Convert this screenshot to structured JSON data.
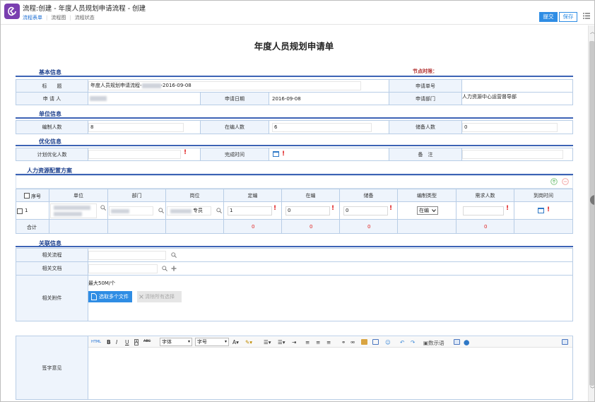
{
  "window": {
    "title": "流程:创建 - 年度人员规划申请流程 - 创建",
    "tabs": [
      "流程表单",
      "流程图",
      "流程状态"
    ],
    "submit_label": "提交",
    "save_label": "保存"
  },
  "form": {
    "title": "年度人员规划申请单",
    "node_time_label": "节点时限：",
    "basic": {
      "section": "基本信息",
      "title_label": "标　　题",
      "title_prefix": "年度人员规划申请流程-",
      "title_suffix": "-2016-09-08",
      "serial_label": "申请单号",
      "applicant_label": "申 请 人",
      "date_label": "申请日期",
      "date_value": "2016-09-08",
      "dept_label": "申请部门",
      "dept_value": "人力资源中心运营督导部"
    },
    "unit": {
      "section": "单位信息",
      "plan_label": "编制人数",
      "plan_value": "8",
      "current_label": "在编人数",
      "current_value": "6",
      "reserve_label": "储备人数",
      "reserve_value": "0"
    },
    "optimize": {
      "section": "优化信息",
      "plan_label": "计划优化人数",
      "finish_label": "完成时间",
      "remark_label": "备　注"
    },
    "staffing": {
      "section": "人力资源配置方案",
      "columns": [
        "序号",
        "单位",
        "部门",
        "岗位",
        "定编",
        "在编",
        "储备",
        "编制类型",
        "需求人数",
        "到岗时间"
      ],
      "row": {
        "index": "1",
        "position_suffix": "专员",
        "fixed": "1",
        "current": "0",
        "reserve": "0",
        "type": "在编"
      },
      "total_label": "合计",
      "totals": [
        "0",
        "0",
        "0",
        "0"
      ]
    },
    "related": {
      "section": "关联信息",
      "process_label": "相关流程",
      "doc_label": "相关文档",
      "attach_label": "相关附件",
      "attach_limit": "最大50M/个",
      "choose_label": "选取多个文件",
      "clear_label": "清除所有选择"
    },
    "sign": {
      "label": "签字意见",
      "font_select": "字体",
      "size_select": "字号",
      "phrase_label": "数示语"
    }
  }
}
